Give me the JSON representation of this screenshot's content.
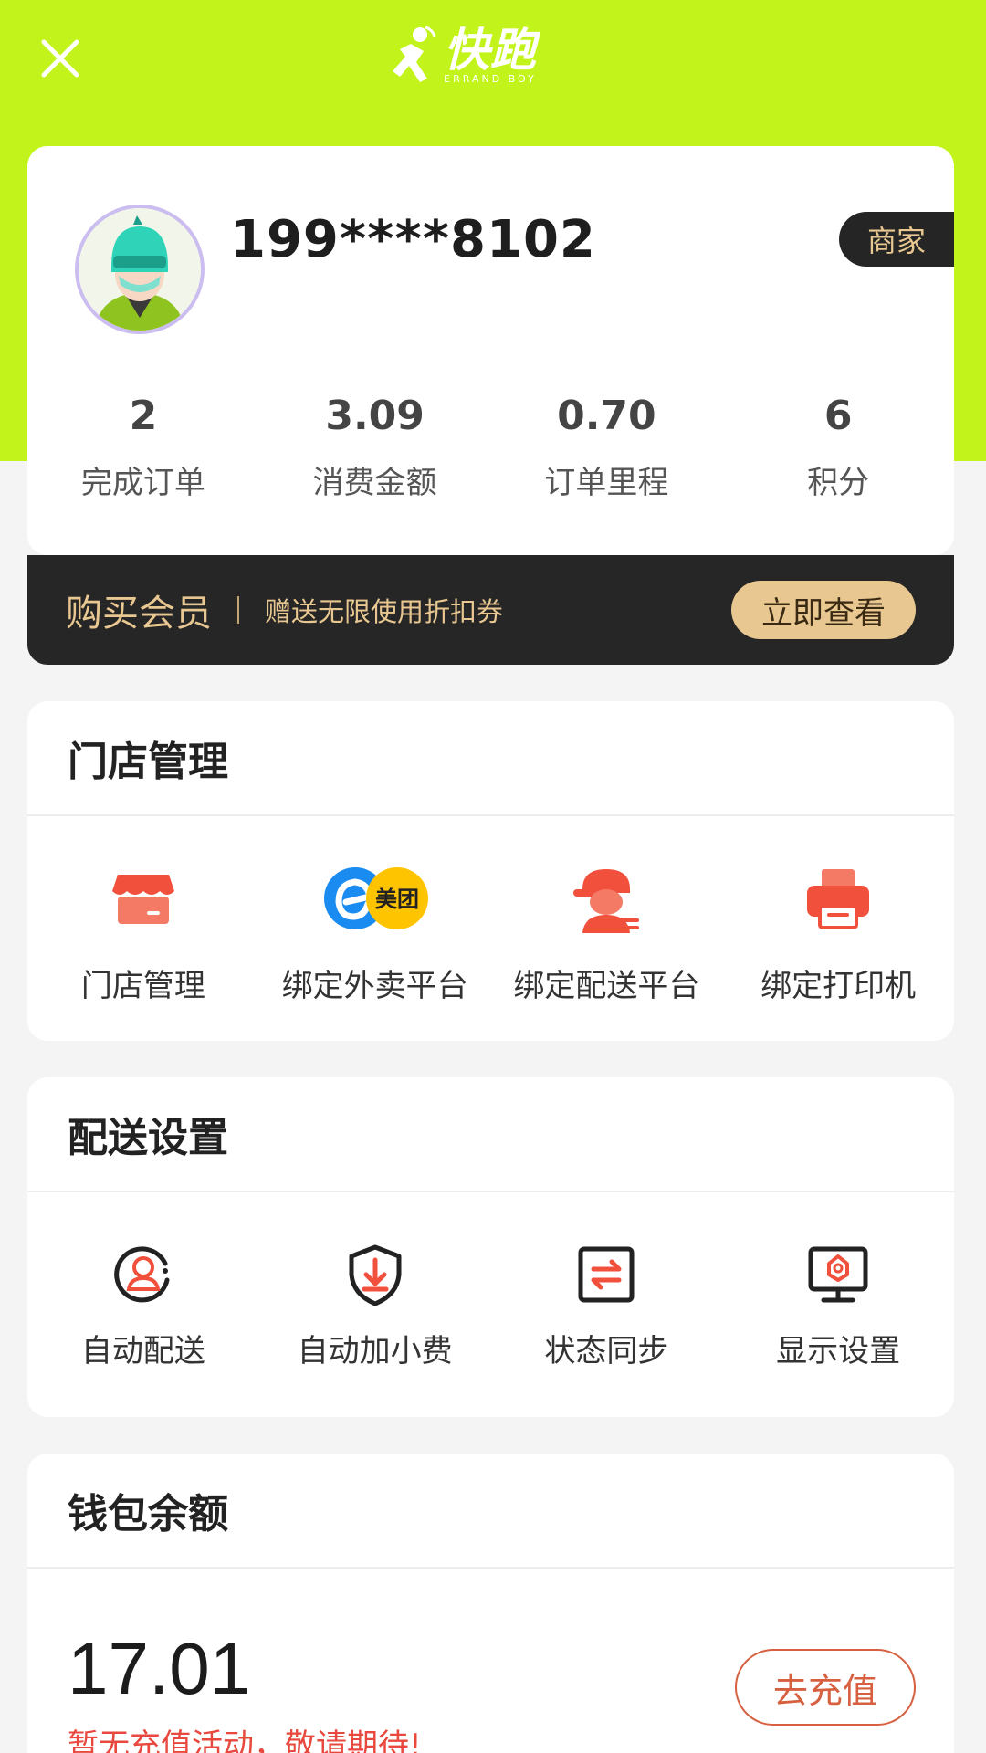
{
  "header": {
    "logo_text": "快跑",
    "logo_subtext": "ERRAND BOY"
  },
  "profile": {
    "phone": "199****8102",
    "tag": "商家",
    "stats": [
      {
        "value": "2",
        "label": "完成订单"
      },
      {
        "value": "3.09",
        "label": "消费金额"
      },
      {
        "value": "0.70",
        "label": "订单里程"
      },
      {
        "value": "6",
        "label": "积分"
      }
    ]
  },
  "vip": {
    "title": "购买会员",
    "desc": "赠送无限使用折扣券",
    "button": "立即查看"
  },
  "store": {
    "title": "门店管理",
    "items": [
      {
        "label": "门店管理",
        "icon": "storefront-icon"
      },
      {
        "label": "绑定外卖平台",
        "icon": "eleme-meituan-icon",
        "badge_text": "美团"
      },
      {
        "label": "绑定配送平台",
        "icon": "courier-icon"
      },
      {
        "label": "绑定打印机",
        "icon": "printer-icon"
      }
    ]
  },
  "delivery": {
    "title": "配送设置",
    "items": [
      {
        "label": "自动配送",
        "icon": "auto-dispatch-icon"
      },
      {
        "label": "自动加小费",
        "icon": "shield-download-icon"
      },
      {
        "label": "状态同步",
        "icon": "sync-icon"
      },
      {
        "label": "显示设置",
        "icon": "monitor-icon"
      }
    ]
  },
  "wallet": {
    "title": "钱包余额",
    "amount": "17.01",
    "note": "暂无充值活动，敬请期待!",
    "button": "去充值"
  },
  "colors": {
    "brand_green": "#c2f41b",
    "gold": "#e8c790",
    "icon_red": "#f0503c",
    "accent_orange": "#d6603f"
  }
}
